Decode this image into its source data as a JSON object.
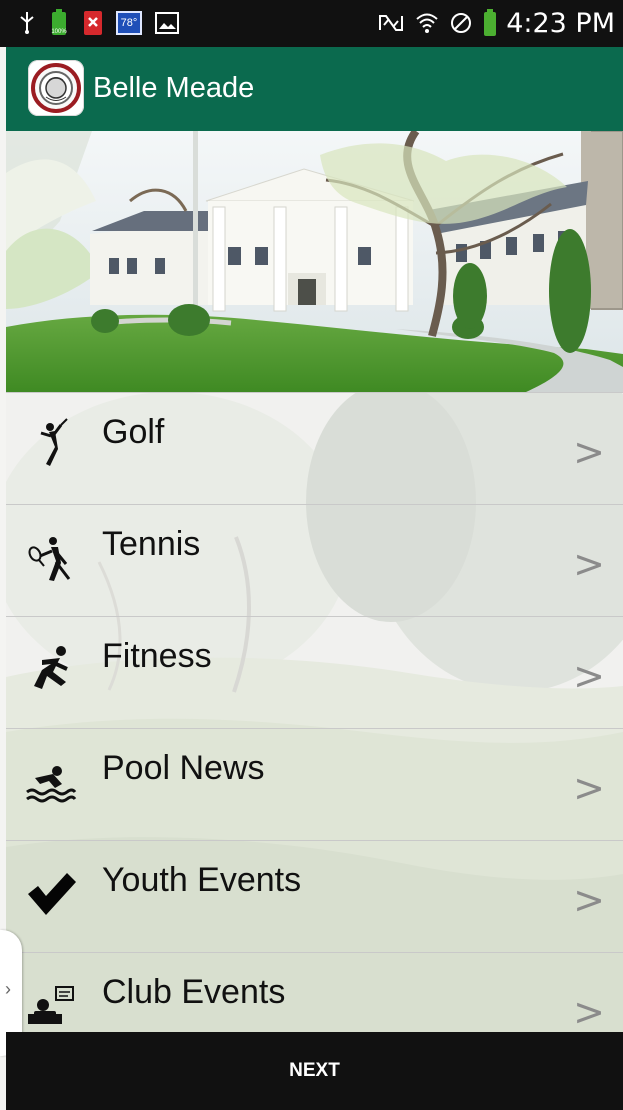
{
  "status_bar": {
    "left_icons": [
      "usb-icon",
      "battery-status-icon",
      "close-notification-icon",
      "weather-icon",
      "image-icon"
    ],
    "weather_temp": "78°",
    "right_icons": [
      "nfc-icon",
      "wifi-icon",
      "do-not-disturb-icon",
      "battery-icon"
    ],
    "time": "4:23 PM"
  },
  "app_bar": {
    "title": "Belle Meade",
    "background_color": "#0b6a4e",
    "logo_icon": "club-logo-icon"
  },
  "hero": {
    "image_name": "clubhouse-photo"
  },
  "menu": {
    "items": [
      {
        "label": "Golf",
        "icon": "golf-icon"
      },
      {
        "label": "Tennis",
        "icon": "tennis-icon"
      },
      {
        "label": "Fitness",
        "icon": "fitness-icon"
      },
      {
        "label": "Pool News",
        "icon": "pool-icon"
      },
      {
        "label": "Youth Events",
        "icon": "checkmark-icon"
      },
      {
        "label": "Club Events",
        "icon": "club-events-icon"
      }
    ],
    "chevron_text": ">"
  },
  "drawer": {
    "arrow_text": "›"
  },
  "footer": {
    "next_label": "NEXT"
  },
  "colors": {
    "status_bar": "#111111",
    "app_bar": "#0b6a4e",
    "footer": "#111111",
    "chevron": "#8b8b8b"
  }
}
